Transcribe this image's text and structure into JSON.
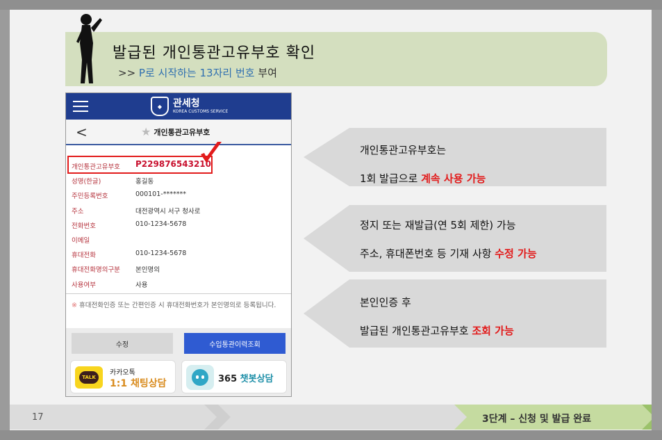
{
  "header": {
    "title": "발급된 개인통관고유부호 확인",
    "subtitle_prefix": ">> ",
    "subtitle_blue": "P로 시작하는 13자리 번호",
    "subtitle_suffix": " 부여"
  },
  "phone": {
    "brand_ko": "관세청",
    "brand_en": "KOREA CUSTOMS SERVICE",
    "page_title": "개인통관고유부호",
    "fields": [
      {
        "label": "개인통관고유부호",
        "value": "P229876543210"
      },
      {
        "label": "성명(한글)",
        "value": "홍길동"
      },
      {
        "label": "주민등록번호",
        "value": "000101-*******"
      },
      {
        "label": "주소",
        "value": "대전광역시 서구 청사로"
      },
      {
        "label": "전화번호",
        "value": "010-1234-5678"
      },
      {
        "label": "이메일",
        "value": ""
      },
      {
        "label": "휴대전화",
        "value": "010-1234-5678"
      },
      {
        "label": "휴대전화명의구분",
        "value": "본인명의"
      },
      {
        "label": "사용여부",
        "value": "사용"
      }
    ],
    "note_mark": "※",
    "note": "휴대전화인증 또는 간편인증 시 휴대전화번호가 본인명의로 등록됩니다.",
    "btn_edit": "수정",
    "btn_history": "수입통관이력조회",
    "kakao_line1": "카카오톡",
    "kakao_line2": "1:1 채팅상담",
    "talk_badge": "TALK",
    "chatbot_prefix": "365 ",
    "chatbot_teal": "챗봇상담"
  },
  "panels": {
    "p1_line1": "개인통관고유부호는",
    "p1_line2_a": "1회 발급으로 ",
    "p1_line2_red": "계속 사용 가능",
    "p2_line1": "정지 또는 재발급(연 5회 제한) 가능",
    "p2_line2_a": "주소, 휴대폰번호 등 기재 사항 ",
    "p2_line2_red": "수정 가능",
    "p3_line1": "본인인증 후",
    "p3_line2_a": "발급된 개인통관고유부호 ",
    "p3_line2_red": "조회 가능"
  },
  "footer": {
    "page_number": "17",
    "step": "3단계 – 신청 및 발급 완료"
  },
  "colors": {
    "accent_red": "#e21b1b",
    "header_green": "#d4dfbf",
    "customs_blue": "#1f3d8f"
  }
}
